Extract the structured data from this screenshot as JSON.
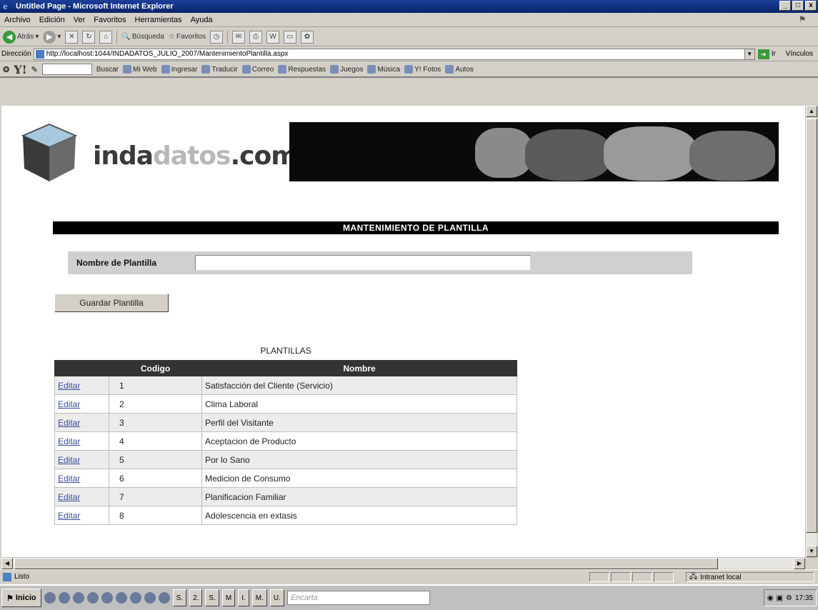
{
  "window": {
    "title": "Untitled Page - Microsoft Internet Explorer",
    "buttons": [
      "_",
      "□",
      "x"
    ]
  },
  "menu": [
    "Archivo",
    "Edición",
    "Ver",
    "Favoritos",
    "Herramientas",
    "Ayuda"
  ],
  "toolbar": {
    "back": "Atrás",
    "search": "Búsqueda",
    "favorites": "Favoritos"
  },
  "address": {
    "label": "Dirección",
    "url": "http://localhost:1044/INDADATOS_JULIO_2007/MantenimientoPlantilla.aspx",
    "go": "Ir",
    "links": "Vínculos"
  },
  "yahoo": {
    "logo": "Y!",
    "search_button": "Buscar",
    "items": [
      "Mi Web",
      "Ingresar",
      "Traducir",
      "Correo",
      "Respuestas",
      "Juegos",
      "Música",
      "Y! Fotos",
      "Autos"
    ]
  },
  "logo": {
    "prefix": "inda",
    "dim": "datos",
    "suffix": ".com"
  },
  "page": {
    "section_title": "MANTENIMIENTO DE PLANTILLA",
    "name_label": "Nombre de Plantilla",
    "name_value": "",
    "save_button": "Guardar Plantilla",
    "table_caption": "PLANTILLAS",
    "columns": [
      "",
      "Codigo",
      "Nombre"
    ],
    "edit_label": "Editar",
    "rows": [
      {
        "code": "1",
        "name": "Satisfacción del Cliente (Servicio)"
      },
      {
        "code": "2",
        "name": "Clima Laboral"
      },
      {
        "code": "3",
        "name": "Perfil del Visitante"
      },
      {
        "code": "4",
        "name": "Aceptacion de Producto"
      },
      {
        "code": "5",
        "name": "Por lo Sano"
      },
      {
        "code": "6",
        "name": "Medicion de Consumo"
      },
      {
        "code": "7",
        "name": "Planificacion Familiar"
      },
      {
        "code": "8",
        "name": "Adolescencia en extasis"
      }
    ]
  },
  "status": {
    "text": "Listo",
    "zone": "Intranet local"
  },
  "taskbar": {
    "start": "Inicio",
    "tasks": [
      "S.",
      "2.",
      "S.",
      "M",
      "I.",
      "M.",
      "U."
    ],
    "encarta": "Encarta",
    "clock": "17:35"
  }
}
